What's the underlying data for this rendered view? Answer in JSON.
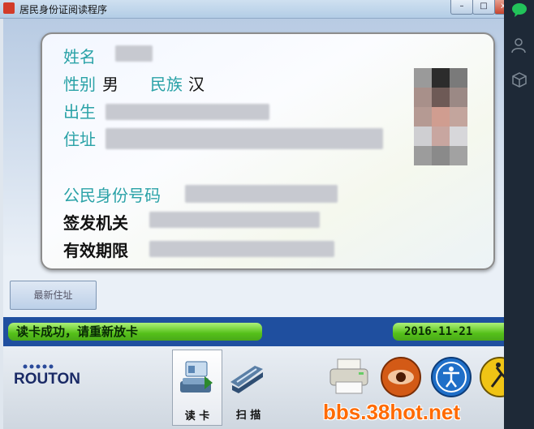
{
  "window": {
    "title": "居民身份证阅读程序",
    "min_symbol": "–",
    "max_symbol": "□",
    "close_symbol": "x"
  },
  "card": {
    "name_label": "姓名",
    "gender_label": "性别",
    "gender_value": "男",
    "ethnicity_label": "民族",
    "ethnicity_value": "汉",
    "birth_label": "出生",
    "address_label": "住址",
    "id_number_label": "公民身份号码",
    "issuer_label": "签发机关",
    "validity_label": "有效期限"
  },
  "latest_address_button": "最新住址",
  "status": {
    "message": "读卡成功，请重新放卡",
    "date": "2016-11-21"
  },
  "toolbar": {
    "logo": "ROUTON",
    "read_card": "读 卡",
    "scan": "扫 描"
  },
  "watermark": "bbs.38hot.net",
  "colors": {
    "label_teal": "#2aa2a7",
    "status_green": "#55c019",
    "status_band": "#1f4f9f"
  },
  "icons": [
    "app-icon",
    "id-card-reader-icon",
    "scanner-icon",
    "printer-icon",
    "eye-icon",
    "accessibility-icon",
    "running-man-icon",
    "chat-icon",
    "user-icon",
    "box-icon"
  ]
}
